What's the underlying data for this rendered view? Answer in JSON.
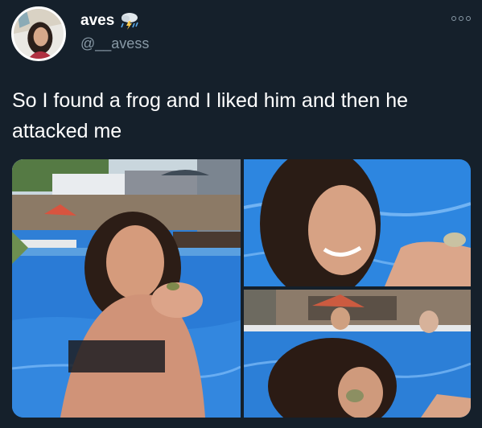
{
  "tweet": {
    "display_name": "aves",
    "name_emoji": "cloud-with-lightning-and-rain-icon",
    "handle": "@__avess",
    "text": "So I found a frog and I liked him and then he attacked me",
    "more_icon": "more-options-icon"
  },
  "media": {
    "photos": [
      {
        "name": "photo-girl-holding-frog"
      },
      {
        "name": "photo-girl-smiling-at-frog"
      },
      {
        "name": "photo-frog-attacks-face"
      }
    ]
  },
  "colors": {
    "background": "#15202b",
    "text_primary": "#ffffff",
    "text_secondary": "#8899a6",
    "pool_blue": "#2f7fd6"
  }
}
